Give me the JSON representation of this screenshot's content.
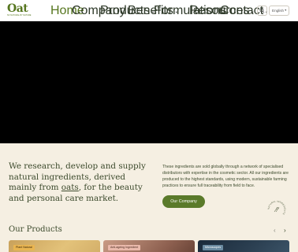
{
  "brand": {
    "logo_text": "Oat",
    "logo_sub": "SO NATURAL BY NATURE"
  },
  "nav": {
    "items": [
      {
        "label": "Home"
      },
      {
        "label": "Company"
      },
      {
        "label": "Products"
      },
      {
        "label": "Benefits"
      },
      {
        "label": "Formulations"
      },
      {
        "label": "Resources"
      },
      {
        "label": "Contact"
      }
    ],
    "language": "English"
  },
  "intro": {
    "heading_before": "We research, develop and supply natural ingredients, derived mainly from ",
    "heading_link": "oats",
    "heading_after": ", for the beauty and personal care market.",
    "body": "These ingredients are sold globally through a network of specialised distributors with expertise in the cosmetic sector. All our ingredients are produced to the highest standards, using modern, sustainable farming practices to ensure full traceability from field to face.",
    "button": "Our Company",
    "badge_text": "NATURAL INGREDIENTS"
  },
  "products": {
    "title": "Our Products",
    "cards": [
      {
        "tag": "Plant Natural"
      },
      {
        "tag": "Anti-ageing Ingredient"
      },
      {
        "tag": "Microscopes"
      }
    ]
  },
  "colors": {
    "accent": "#5a7a2a",
    "background": "#f5efe2",
    "hero": "#000000"
  },
  "icons": [
    "search-icon",
    "chevron-down-icon",
    "chevron-left-icon",
    "chevron-right-icon"
  ]
}
